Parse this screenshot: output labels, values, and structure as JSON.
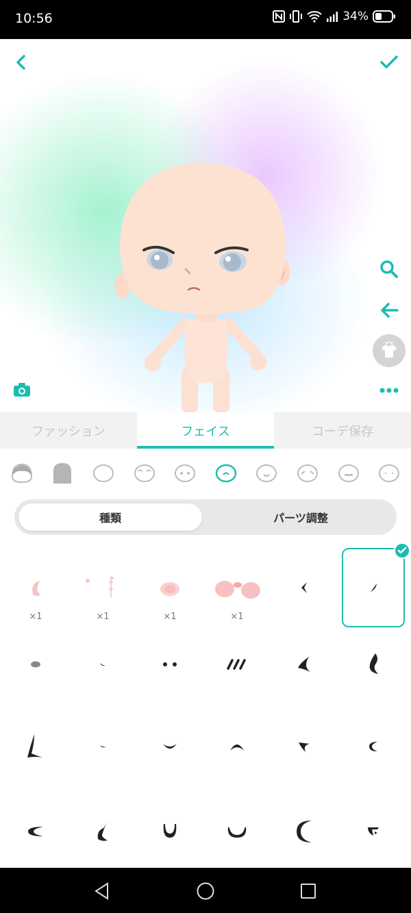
{
  "status_bar": {
    "time": "10:56",
    "battery": "34%"
  },
  "stage": {
    "back_icon": "chevron-left-icon",
    "confirm_icon": "check-icon",
    "camera_icon": "camera-icon",
    "zoom_icon": "search-icon",
    "undo_icon": "arrow-left-icon",
    "outfit_icon": "shirt-icon",
    "more_icon": "more-dots-icon"
  },
  "tabs": [
    {
      "label": "ファッション",
      "active": false
    },
    {
      "label": "フェイス",
      "active": true
    },
    {
      "label": "コーデ保存",
      "active": false
    }
  ],
  "face_categories": [
    "hair-front",
    "hair-back",
    "face-outline",
    "eyebrows",
    "eyes",
    "mouth",
    "mouth-smile",
    "eyebrow-worry",
    "mustache",
    "face-dots"
  ],
  "segment": {
    "type_label": "種類",
    "adjust_label": "パーツ調整"
  },
  "parts_grid": {
    "counts": [
      "×1",
      "×1",
      "×1",
      "×1"
    ],
    "selected_index": 5
  },
  "colors": {
    "accent": "#1cbdb0",
    "inactive_tab": "#c6c6c6"
  }
}
